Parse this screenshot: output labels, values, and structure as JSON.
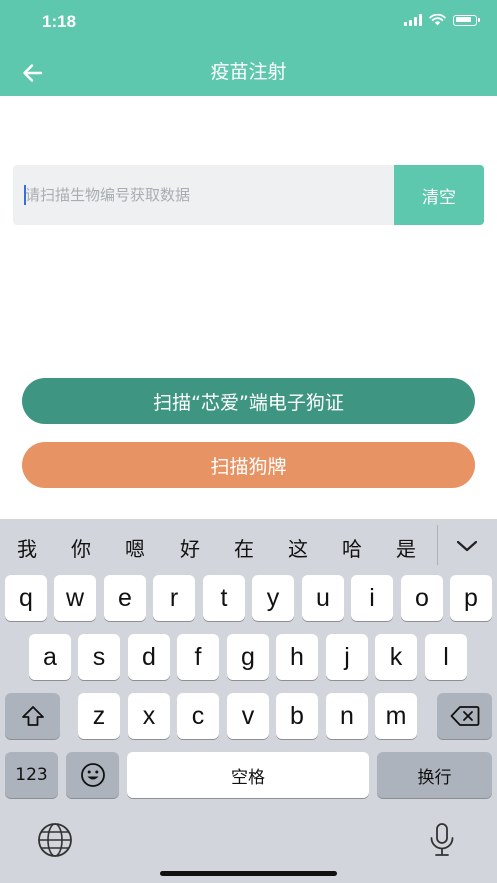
{
  "status_bar": {
    "time": "1:18"
  },
  "nav": {
    "title": "疫苗注射",
    "back_icon": "arrow-left-icon"
  },
  "scan": {
    "placeholder": "请扫描生物编号获取数据",
    "value": "",
    "clear_label": "清空"
  },
  "actions": {
    "scan_electronic_label": "扫描“芯爱”端电子狗证",
    "scan_tag_label": "扫描狗牌"
  },
  "keyboard": {
    "candidates": [
      "我",
      "你",
      "嗯",
      "好",
      "在",
      "这",
      "哈",
      "是"
    ],
    "row1": [
      "q",
      "w",
      "e",
      "r",
      "t",
      "y",
      "u",
      "i",
      "o",
      "p"
    ],
    "row2": [
      "a",
      "s",
      "d",
      "f",
      "g",
      "h",
      "j",
      "k",
      "l"
    ],
    "row3": [
      "z",
      "x",
      "c",
      "v",
      "b",
      "n",
      "m"
    ],
    "numbers_label": "123",
    "space_label": "空格",
    "return_label": "换行"
  },
  "colors": {
    "header": "#5dc8ae",
    "primary_button": "#3e9682",
    "secondary_button": "#e89364"
  }
}
